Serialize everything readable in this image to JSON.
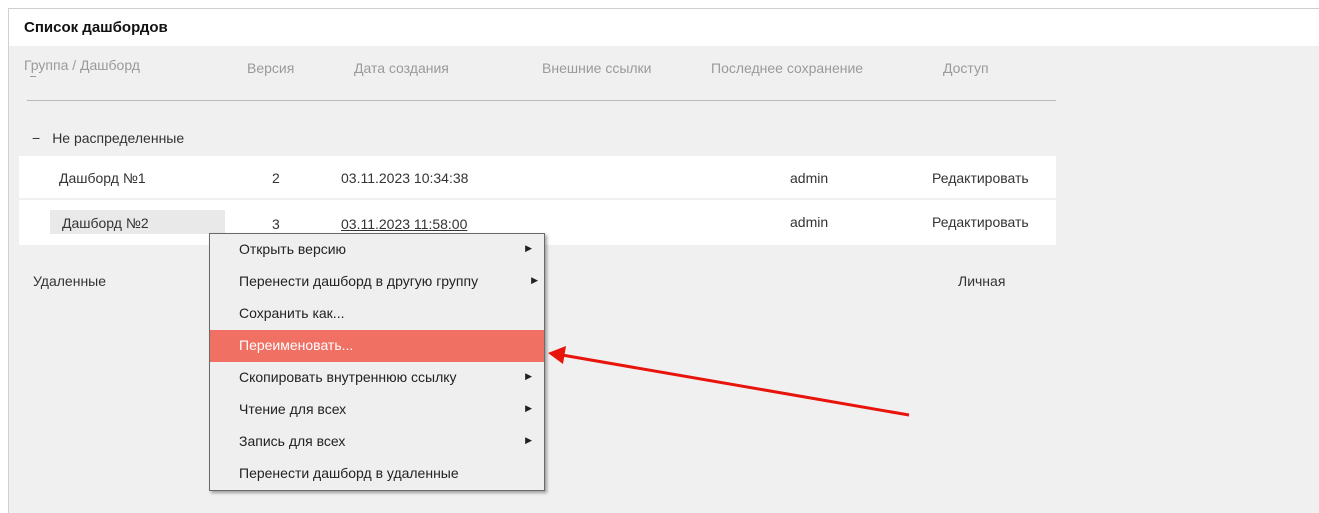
{
  "panel": {
    "title": "Список дашбордов"
  },
  "columns": {
    "group": "Группа / Дашборд",
    "version": "Версия",
    "created": "Дата создания",
    "links": "Внешние ссылки",
    "last_saved": "Последнее сохранение",
    "access": "Доступ"
  },
  "group": {
    "toggle": "−",
    "name": "Не распределенные"
  },
  "rows": [
    {
      "name": "Дашборд №1",
      "version": "2",
      "created": "03.11.2023 10:34:38",
      "user": "admin",
      "access": "Редактировать"
    },
    {
      "name": "Дашборд №2",
      "version": "3",
      "created": "03.11.2023 11:58:00",
      "user": "admin",
      "access": "Редактировать"
    }
  ],
  "deleted_group": {
    "name": "Удаленные",
    "access": "Личная"
  },
  "context_menu": {
    "items": [
      {
        "label": "Открыть версию",
        "submenu_arrow": "▶"
      },
      {
        "label": "Перенести дашборд в другую группу",
        "submenu_arrow": "▶"
      },
      {
        "label": "Сохранить как...",
        "submenu_arrow": ""
      },
      {
        "label": "Переименовать...",
        "submenu_arrow": ""
      },
      {
        "label": "Скопировать внутреннюю ссылку",
        "submenu_arrow": "▶"
      },
      {
        "label": "Чтение для всех",
        "submenu_arrow": "▶"
      },
      {
        "label": "Запись для всех",
        "submenu_arrow": "▶"
      },
      {
        "label": "Перенести дашборд в удаленные",
        "submenu_arrow": ""
      }
    ],
    "highlight_color": "#f07163"
  },
  "annotation": {
    "arrow_color": "#e8140c"
  }
}
